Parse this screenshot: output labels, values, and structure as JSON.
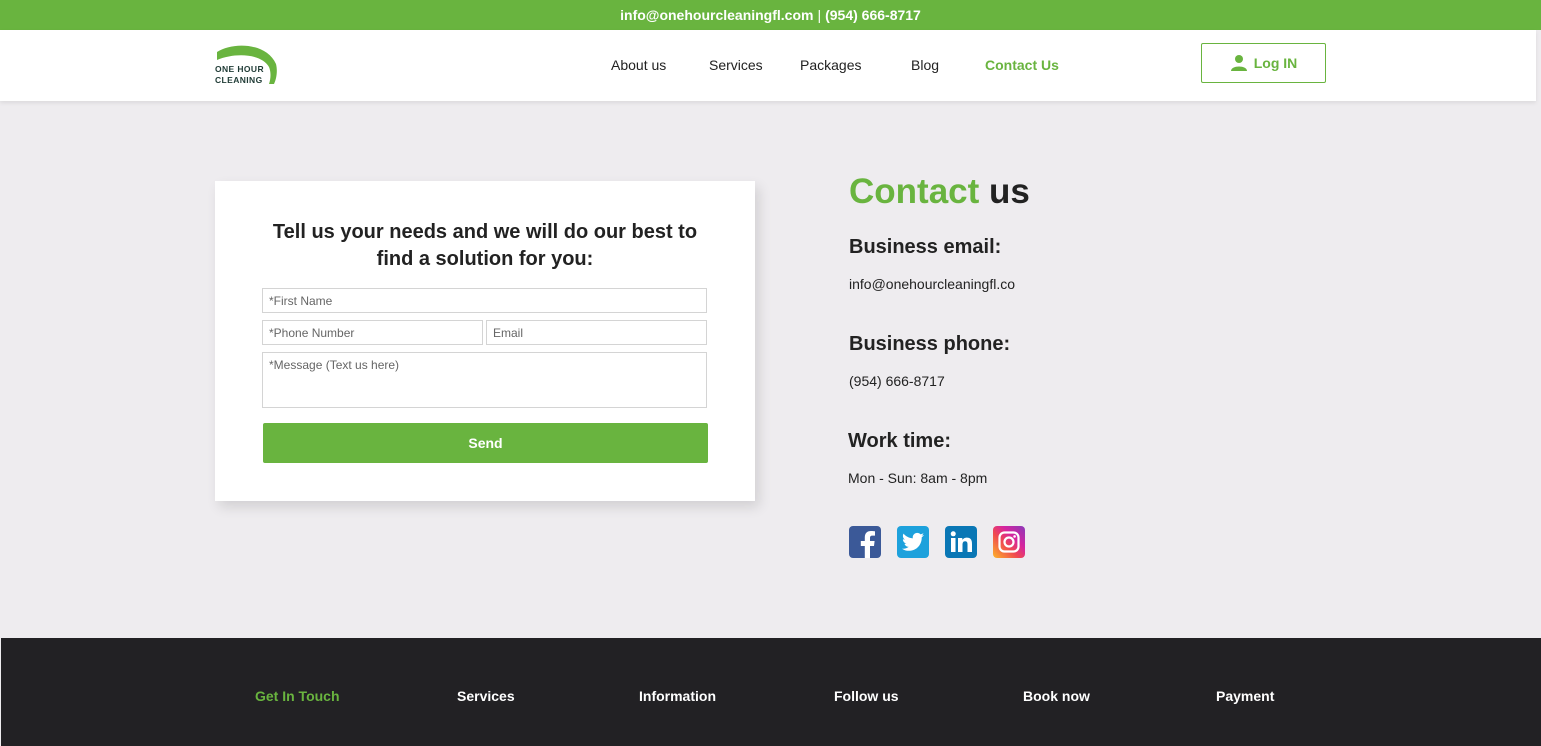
{
  "topbar": {
    "email": "info@onehourcleaningfl.com",
    "separator": "|",
    "phone": "(954) 666-8717"
  },
  "header": {
    "logo": {
      "line1": "ONE HOUR",
      "line2": "CLEANING"
    },
    "nav": [
      {
        "label": "About us",
        "active": false
      },
      {
        "label": "Services",
        "active": false
      },
      {
        "label": "Packages",
        "active": false
      },
      {
        "label": "Blog",
        "active": false
      },
      {
        "label": "Contact Us",
        "active": true
      }
    ],
    "login": {
      "label": "Log IN",
      "icon": "user-icon"
    }
  },
  "form": {
    "heading": "Tell us your needs and we will do our best to find a solution for you:",
    "fields": {
      "first_name": {
        "placeholder": "*First Name",
        "value": ""
      },
      "phone": {
        "placeholder": "*Phone Number",
        "value": ""
      },
      "email": {
        "placeholder": "Email",
        "value": ""
      },
      "message": {
        "placeholder": "*Message (Text us here)",
        "value": ""
      }
    },
    "send_label": "Send"
  },
  "contact": {
    "title_green": "Contact",
    "title_dark": "us",
    "email_label": "Business email:",
    "email_value": "info@onehourcleaningfl.co",
    "phone_label": "Business phone:",
    "phone_value": "(954) 666-8717",
    "work_label": "Work time:",
    "work_value": "Mon - Sun: 8am - 8pm",
    "socials": [
      {
        "name": "facebook",
        "icon": "facebook-icon",
        "color": "#3b5998"
      },
      {
        "name": "twitter",
        "icon": "twitter-icon",
        "color": "#1da1dc"
      },
      {
        "name": "linkedin",
        "icon": "linkedin-icon",
        "color": "#0a77b5"
      },
      {
        "name": "instagram",
        "icon": "instagram-icon",
        "color": "#d6249f"
      }
    ]
  },
  "footer": {
    "columns": [
      {
        "label": "Get In Touch",
        "active": true
      },
      {
        "label": "Services",
        "active": false
      },
      {
        "label": "Information",
        "active": false
      },
      {
        "label": "Follow us",
        "active": false
      },
      {
        "label": "Book now",
        "active": false
      },
      {
        "label": "Payment",
        "active": false
      }
    ]
  },
  "colors": {
    "brand_green": "#69b43f",
    "background": "#eeecef",
    "footer_bg": "#222124",
    "text_dark": "#222222"
  }
}
